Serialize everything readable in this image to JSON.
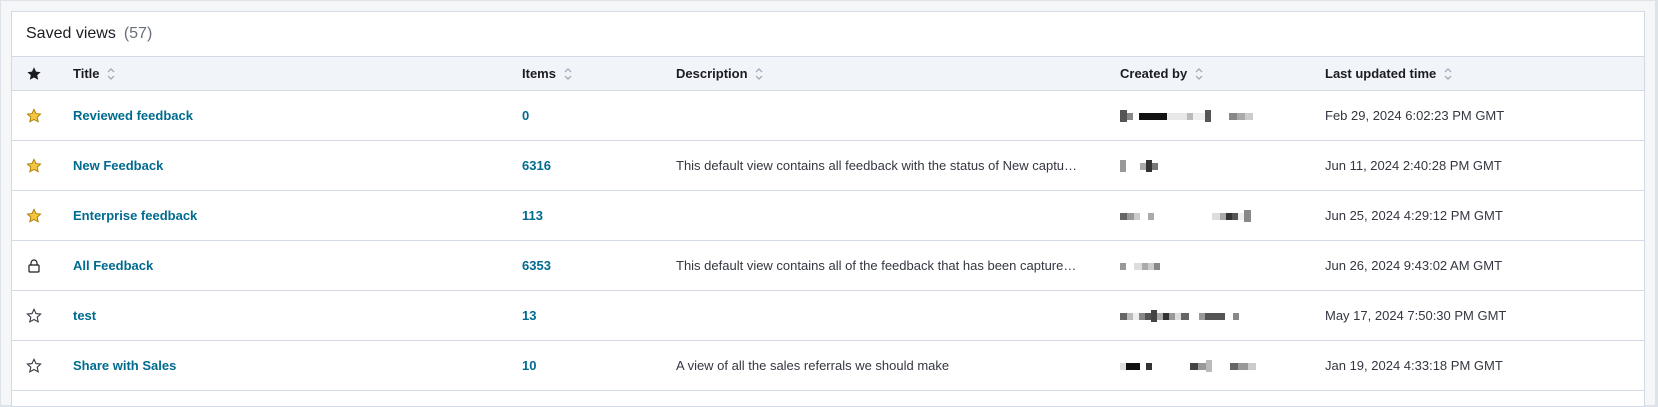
{
  "panel": {
    "title": "Saved views",
    "count": "(57)"
  },
  "table": {
    "headers": {
      "title": "Title",
      "items": "Items",
      "description": "Description",
      "created_by": "Created by",
      "last_updated": "Last updated time"
    },
    "rows": [
      {
        "icon": "star-filled-icon",
        "title": "Reviewed feedback",
        "items": "0",
        "description": "",
        "updated": "Feb 29, 2024 6:02:23 PM GMT"
      },
      {
        "icon": "star-filled-icon",
        "title": "New Feedback",
        "items": "6316",
        "description": "This default view contains all feedback with the status of New captu…",
        "updated": "Jun 11, 2024 2:40:28 PM GMT"
      },
      {
        "icon": "star-filled-icon",
        "title": "Enterprise feedback",
        "items": "113",
        "description": "",
        "updated": "Jun 25, 2024 4:29:12 PM GMT"
      },
      {
        "icon": "lock-icon",
        "title": "All Feedback",
        "items": "6353",
        "description": "This default view contains all of the feedback that has been capture…",
        "updated": "Jun 26, 2024 9:43:02 AM GMT"
      },
      {
        "icon": "star-outline-icon",
        "title": "test",
        "items": "13",
        "description": "",
        "updated": "May 17, 2024 7:50:30 PM GMT"
      },
      {
        "icon": "star-outline-icon",
        "title": "Share with Sales",
        "items": "10",
        "description": "A view of all the sales referrals we should make",
        "updated": "Jan 19, 2024 4:33:18 PM GMT"
      }
    ]
  },
  "colors": {
    "link": "#006b8f",
    "star_filled": "#f5a700",
    "border": "#d3dae6",
    "header_bg": "#f1f4f9"
  }
}
